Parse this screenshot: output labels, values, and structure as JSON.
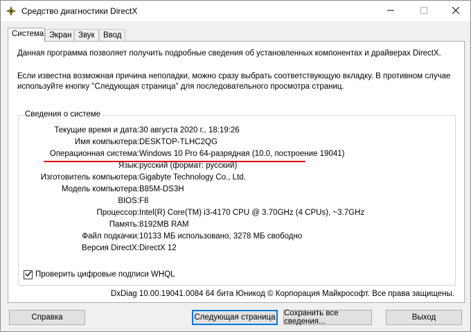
{
  "window": {
    "title": "Средство диагностики DirectX"
  },
  "tabs": [
    {
      "label": "Система"
    },
    {
      "label": "Экран"
    },
    {
      "label": "Звук"
    },
    {
      "label": "Ввод"
    }
  ],
  "intro": {
    "line1": "Данная программа позволяет получить подробные сведения об установленных компонентах и драйверах DirectX.",
    "line2": "Если известна возможная причина неполадки, можно сразу выбрать соответствующую вкладку. В противном случае используйте кнопку \"Следующая страница\" для последовательного просмотра страниц."
  },
  "system_info": {
    "group_title": "Сведения о системе",
    "rows": [
      {
        "label": "Текущие время и дата:",
        "value": "30 августа 2020 г., 18:19:26"
      },
      {
        "label": "Имя компьютера:",
        "value": "DESKTOP-TLHC2QG"
      },
      {
        "label": "Операционная система:",
        "value": "Windows 10 Pro 64-разрядная (10.0, построение 19041)"
      },
      {
        "label": "Язык:",
        "value": "русский (формат: русский)"
      },
      {
        "label": "Изготовитель компьютера:",
        "value": "Gigabyte Technology Co., Ltd."
      },
      {
        "label": "Модель компьютера:",
        "value": "B85M-DS3H"
      },
      {
        "label": "BIOS:",
        "value": "F8"
      },
      {
        "label": "Процессор:",
        "value": "Intel(R) Core(TM) i3-4170 CPU @ 3.70GHz (4 CPUs), ~3.7GHz"
      },
      {
        "label": "Память:",
        "value": "8192MB RAM"
      },
      {
        "label": "Файл подкачки:",
        "value": "10133 МБ использовано, 3278 МБ свободно"
      },
      {
        "label": "Версия DirectX:",
        "value": "DirectX 12"
      }
    ]
  },
  "whql_checkbox": {
    "label": "Проверить цифровые подписи WHQL",
    "checked": true
  },
  "copyright": "DxDiag 10.00.19041.0084 64 бита Юникод © Корпорация Майкрософт. Все права защищены.",
  "buttons": {
    "help": "Справка",
    "next": "Следующая страница",
    "save": "Сохранить все сведения...",
    "exit": "Выход"
  },
  "colors": {
    "highlight_underline": "#d80000",
    "default_button_border": "#0078d7"
  },
  "icons": {
    "app": "directx-icon",
    "minimize": "minimize-icon",
    "maximize": "maximize-icon",
    "close": "close-icon",
    "checkbox": "checkmark-icon"
  }
}
